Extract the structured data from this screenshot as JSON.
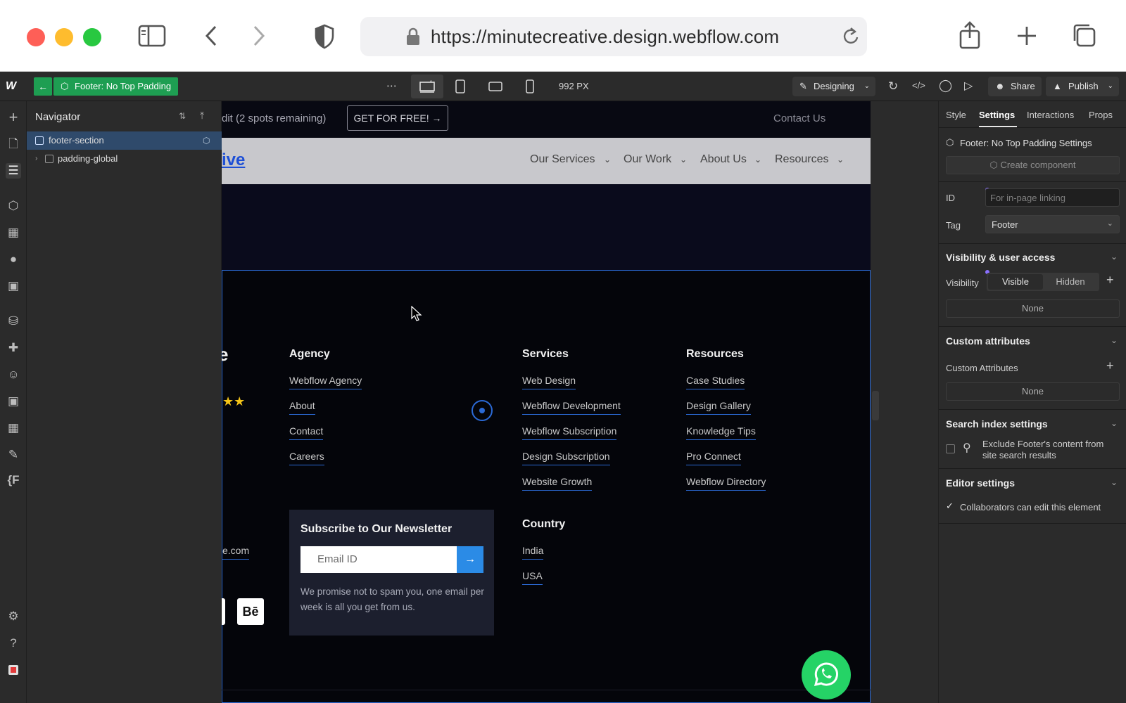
{
  "browser": {
    "url": "https://minutecreative.design.webflow.com"
  },
  "topbar": {
    "component_name": "Footer: No Top Padding",
    "more": "⋯",
    "width_px": "992 PX",
    "mode": "Designing",
    "share": "Share",
    "publish": "Publish"
  },
  "navigator": {
    "title": "Navigator",
    "items": [
      {
        "label": "footer-section"
      },
      {
        "label": "padding-global"
      }
    ]
  },
  "canvas": {
    "promo_text": "dit (2 spots remaining)",
    "promo_button": "GET FOR FREE! →",
    "contact_link": "Contact Us",
    "logo_fragment": "ive",
    "nav_items": [
      "Our Services",
      "Our Work",
      "About Us",
      "Resources"
    ],
    "footer": {
      "brand_fragment": "e",
      "stars": "★★",
      "email_fragment": "e.com",
      "behance_label": "Bē",
      "agency": {
        "heading": "Agency",
        "links": [
          "Webflow Agency",
          "About",
          "Contact",
          "Careers"
        ]
      },
      "services": {
        "heading": "Services",
        "links": [
          "Web Design",
          "Webflow Development",
          "Webflow Subscription",
          "Design Subscription",
          "Website Growth"
        ]
      },
      "resources": {
        "heading": "Resources",
        "links": [
          "Case Studies",
          "Design Gallery",
          "Knowledge Tips",
          "Pro Connect",
          "Webflow Directory"
        ]
      },
      "country": {
        "heading": "Country",
        "links": [
          "India",
          "USA"
        ]
      },
      "newsletter": {
        "heading": "Subscribe to Our Newsletter",
        "placeholder": "Email ID",
        "note": "We promise not to spam you, one email per week is all you get from us."
      }
    }
  },
  "right_panel": {
    "tabs": [
      "Style",
      "Settings",
      "Interactions",
      "Props"
    ],
    "active_tab": "Settings",
    "component_settings": "Footer: No Top Padding Settings",
    "create_component": "Create component",
    "id_label": "ID",
    "id_placeholder": "For in-page linking",
    "tag_label": "Tag",
    "tag_value": "Footer",
    "visibility_heading": "Visibility & user access",
    "visibility_label": "Visibility",
    "visibility_options": [
      "Visible",
      "Hidden"
    ],
    "visibility_none": "None",
    "custom_attr_heading": "Custom attributes",
    "custom_attr_label": "Custom Attributes",
    "custom_attr_none": "None",
    "search_index_heading": "Search index settings",
    "search_index_text": "Exclude Footer's content from site search results",
    "editor_heading": "Editor settings",
    "editor_text": "Collaborators can edit this element"
  },
  "colors": {
    "accent_blue": "#2b6ad6",
    "component_green": "#1e9e52",
    "whatsapp_green": "#25d366"
  }
}
